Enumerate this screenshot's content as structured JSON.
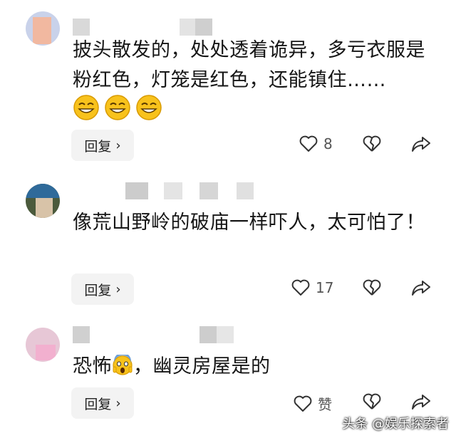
{
  "comments": [
    {
      "text": "披头散发的，处处透着诡异，多亏衣服是粉红色，灯笼是红色，还能镇住……",
      "emoji_icon": "grinning-squint-icon",
      "reply_label": "回复",
      "like_count": "8"
    },
    {
      "text": "像荒山野岭的破庙一样吓人，太可怕了！",
      "reply_label": "回复",
      "like_count": "17"
    },
    {
      "text_before": "恐怖",
      "emoji_icon": "scream-emoji-icon",
      "text_after": "，幽灵房屋是的",
      "reply_label": "回复",
      "like_label": "赞"
    }
  ],
  "watermark": "头条 @娱乐探索者",
  "colors": {
    "accent_reply_bg": "#f3f3f3",
    "text": "#161616"
  }
}
